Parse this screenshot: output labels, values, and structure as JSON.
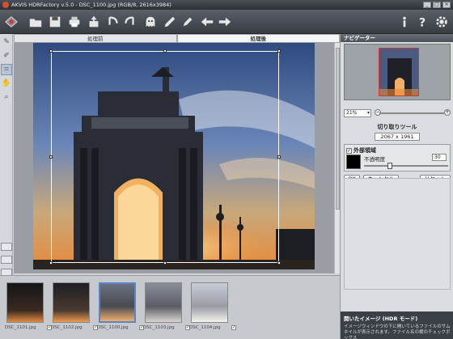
{
  "window": {
    "title": "AKVIS HDRFactory v.5.0 - DSC_1100.jpg (RGB/8, 2616x3984)",
    "controls": [
      "_",
      "□",
      "×"
    ]
  },
  "toolbar": {
    "items": [
      {
        "name": "open-icon",
        "glyph": "📂"
      },
      {
        "name": "save-icon",
        "glyph": "💾"
      },
      {
        "name": "print-icon",
        "glyph": "🖶"
      },
      {
        "name": "share-icon",
        "glyph": "⇪"
      },
      {
        "name": "undo-icon",
        "glyph": "↶"
      },
      {
        "name": "redo-icon",
        "glyph": "↷"
      },
      {
        "name": "ghost-icon",
        "glyph": "☺"
      },
      {
        "name": "brush-icon",
        "glyph": "✎"
      },
      {
        "name": "settings-icon",
        "glyph": "⚙"
      },
      {
        "name": "back-icon",
        "glyph": "⇐"
      },
      {
        "name": "forward-icon",
        "glyph": "⇒"
      },
      {
        "name": "info-icon",
        "glyph": "i"
      },
      {
        "name": "help-icon",
        "glyph": "?"
      },
      {
        "name": "gear-icon",
        "glyph": "⚙"
      }
    ]
  },
  "tabs": {
    "before": "処理前",
    "after": "処理後"
  },
  "filmstrip": [
    {
      "name": "DSC_1101.jpg",
      "selected": false
    },
    {
      "name": "DSC_1102.jpg",
      "selected": false
    },
    {
      "name": "DSC_1100.jpg",
      "selected": true
    },
    {
      "name": "DSC_1103.jpg",
      "selected": false
    },
    {
      "name": "DSC_1104.jpg",
      "selected": false
    }
  ],
  "navigator": {
    "title": "ナビゲーター",
    "zoom": "21%"
  },
  "crop": {
    "title": "切り取りツール",
    "size": "2067 x 1961",
    "outer_area_label": "外部領域",
    "opacity_label": "不透明度",
    "opacity_value": "30",
    "opacity_level": 0.3,
    "ok": "OK",
    "cancel": "キャンセル",
    "reset": "リセット"
  },
  "hint": {
    "title": "開いたイメージ (HDR モード)",
    "text": "イメージウィンドウの下に開いているファイルのサムネイルが表示されます。ファイル名の横のチェックボックス"
  }
}
